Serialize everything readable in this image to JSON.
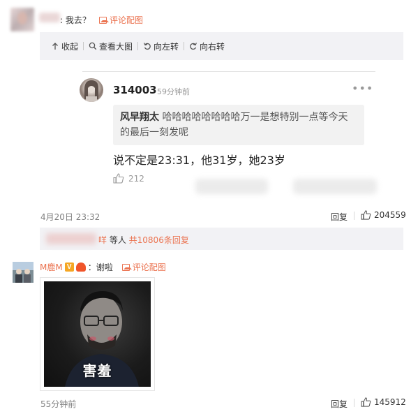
{
  "comment1": {
    "reply_text": ": 我去？",
    "pic_link": "评论配图"
  },
  "panel": {
    "toolbar": {
      "collapse": "收起",
      "view_large": "查看大图",
      "rotate_left": "向左转",
      "rotate_right": "向右转"
    },
    "screenshot": {
      "username": "314003",
      "time": "59分钟前",
      "more": "•••",
      "quote_author": "风早翔太",
      "quote_text": "哈哈哈哈哈哈哈哈万一是想特别一点等今天的最后一刻发呢",
      "main_text": "说不定是23:31，他31岁，她23岁",
      "likes": "212"
    }
  },
  "comment1_meta": {
    "date": "4月20日 23:32",
    "reply": "回复",
    "likes": "204559"
  },
  "more_replies": {
    "suffix_name": "咩",
    "text": " 等人 ",
    "count_link": "共10806条回复"
  },
  "comment2": {
    "username": "M鹿M",
    "vip_badge": "V",
    "reply_text": "：谢啦",
    "pic_link": "评论配图",
    "meme_caption": "害羞",
    "time": "55分钟前",
    "reply": "回复",
    "likes": "145912"
  },
  "colors": {
    "link": "#eb7350",
    "panel_bg": "#f2f2f5"
  }
}
